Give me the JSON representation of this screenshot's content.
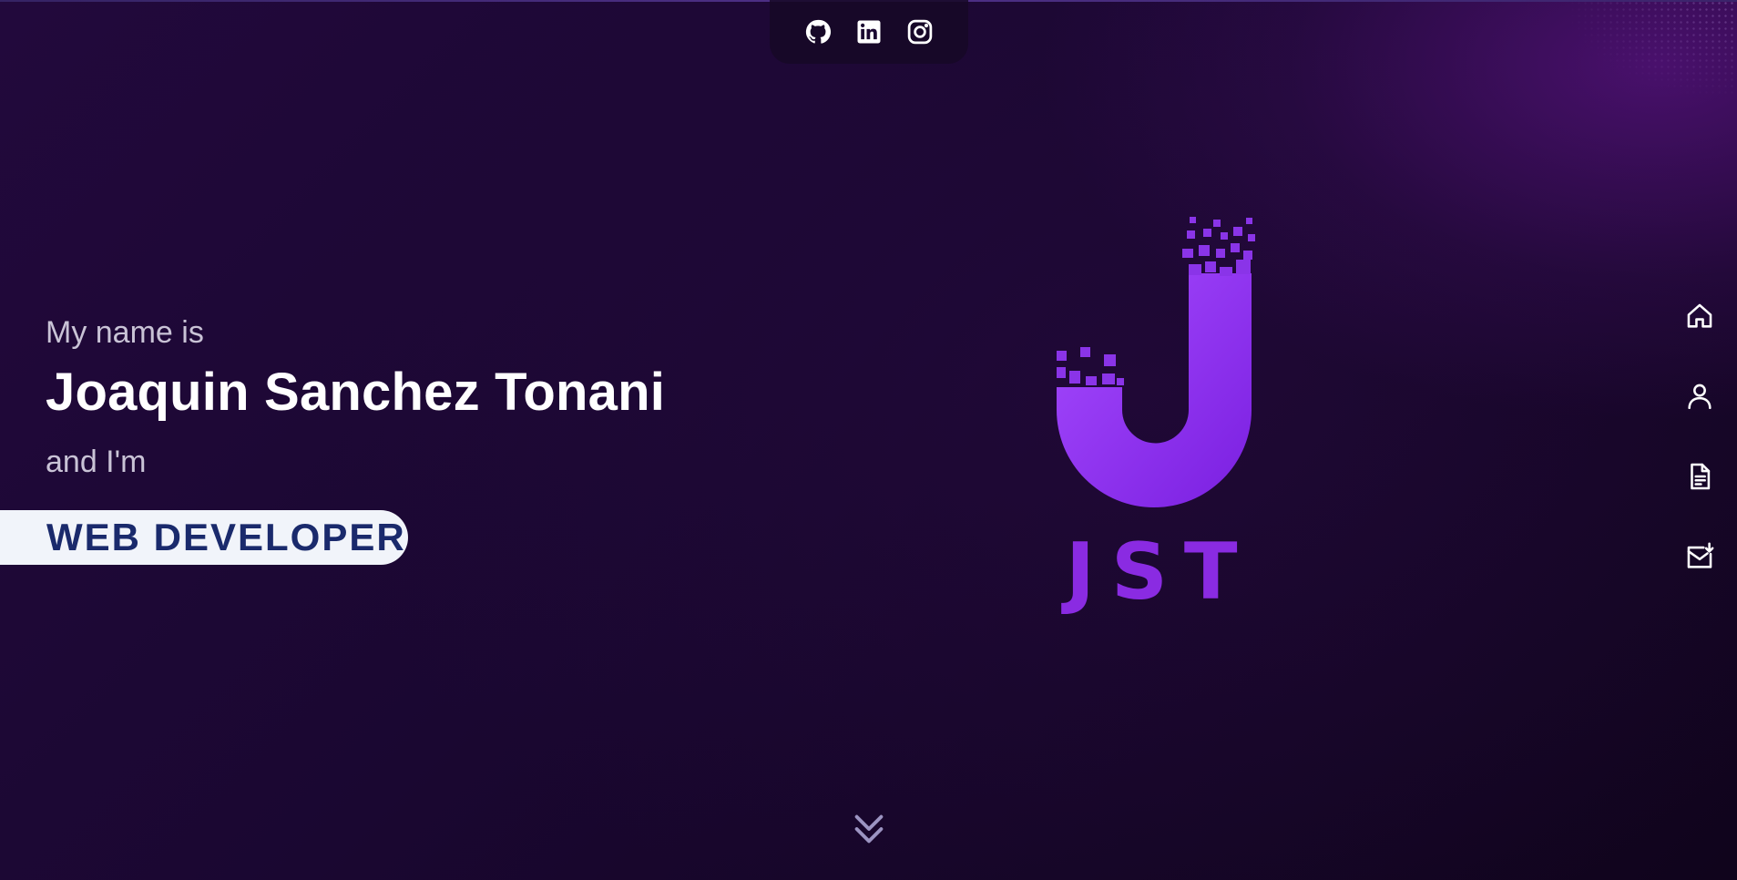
{
  "social": {
    "links": [
      {
        "id": "github",
        "icon": "github-icon"
      },
      {
        "id": "linkedin",
        "icon": "linkedin-icon"
      },
      {
        "id": "instagram",
        "icon": "instagram-icon"
      }
    ]
  },
  "hero": {
    "intro": "My name is",
    "name": "Joaquin Sanchez Tonani",
    "and_im": "and I'm",
    "role": "WEB DEVELOPER"
  },
  "logo": {
    "text": "JST",
    "color": "#8a2be2"
  },
  "side_nav": {
    "items": [
      {
        "id": "home",
        "icon": "home-icon"
      },
      {
        "id": "about",
        "icon": "user-icon"
      },
      {
        "id": "resume",
        "icon": "document-icon"
      },
      {
        "id": "contact",
        "icon": "mail-icon"
      }
    ]
  },
  "scroll": {
    "icon": "double-chevron-down-icon"
  },
  "colors": {
    "background": "#1a0731",
    "accent": "#8a2be2",
    "role_text": "#1a2a6c",
    "pill_bg": "#f1f4fa"
  }
}
